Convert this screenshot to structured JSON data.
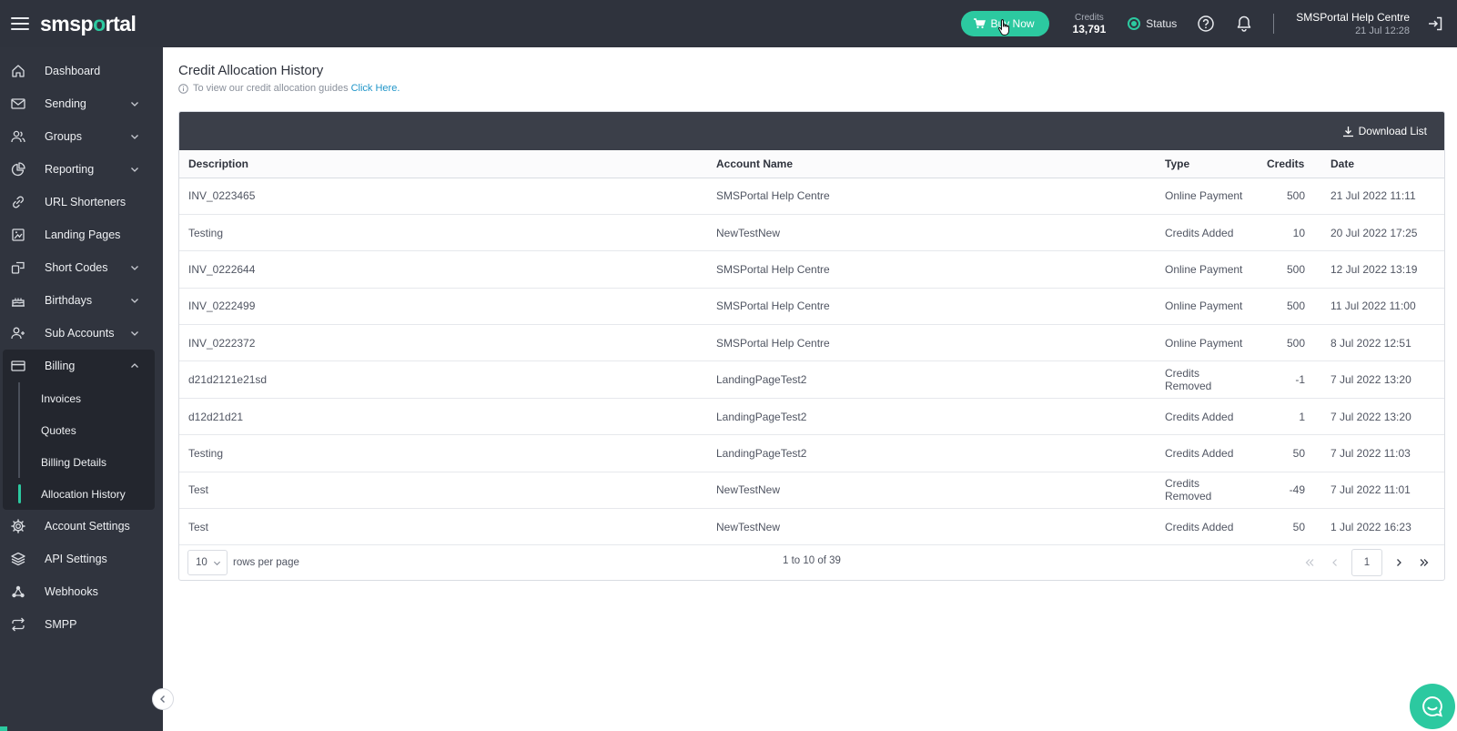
{
  "header": {
    "logo_prefix": "sms",
    "logo_o": "p",
    "logo_accent": "o",
    "logo_suffix": "rtal",
    "buy_label": "Buy Now",
    "credits_label": "Credits",
    "credits_value": "13,791",
    "status_label": "Status",
    "user_name": "SMSPortal Help Centre",
    "user_date": "21 Jul 12:28"
  },
  "sidebar": {
    "items": [
      {
        "label": "Dashboard",
        "icon": "home-icon"
      },
      {
        "label": "Sending",
        "icon": "mail-icon"
      },
      {
        "label": "Groups",
        "icon": "users-icon"
      },
      {
        "label": "Reporting",
        "icon": "pie-chart-icon"
      },
      {
        "label": "URL Shorteners",
        "icon": "link-icon"
      },
      {
        "label": "Landing Pages",
        "icon": "page-icon"
      },
      {
        "label": "Short Codes",
        "icon": "short-codes-icon"
      },
      {
        "label": "Birthdays",
        "icon": "cake-icon"
      },
      {
        "label": "Sub Accounts",
        "icon": "user-plus-icon"
      },
      {
        "label": "Billing",
        "icon": "card-icon"
      },
      {
        "label": "Account Settings",
        "icon": "gear-icon"
      },
      {
        "label": "API Settings",
        "icon": "layers-icon"
      },
      {
        "label": "Webhooks",
        "icon": "webhook-icon"
      },
      {
        "label": "SMPP",
        "icon": "repeat-icon"
      }
    ],
    "billing_sub": [
      "Invoices",
      "Quotes",
      "Billing Details",
      "Allocation History"
    ]
  },
  "main": {
    "title": "Credit Allocation History",
    "hint_text": "To view our credit allocation guides",
    "hint_link": "Click Here.",
    "download_label": "Download List",
    "columns": [
      "Description",
      "Account Name",
      "Type",
      "Credits",
      "Date"
    ],
    "rows": [
      [
        "INV_0223465",
        "SMSPortal Help Centre",
        "Online Payment",
        "500",
        "21 Jul 2022 11:11"
      ],
      [
        "Testing",
        "NewTestNew",
        "Credits Added",
        "10",
        "20 Jul 2022 17:25"
      ],
      [
        "INV_0222644",
        "SMSPortal Help Centre",
        "Online Payment",
        "500",
        "12 Jul 2022 13:19"
      ],
      [
        "INV_0222499",
        "SMSPortal Help Centre",
        "Online Payment",
        "500",
        "11 Jul 2022 11:00"
      ],
      [
        "INV_0222372",
        "SMSPortal Help Centre",
        "Online Payment",
        "500",
        "8 Jul 2022 12:51"
      ],
      [
        "d21d2121e21sd",
        "LandingPageTest2",
        "Credits Removed",
        "-1",
        "7 Jul 2022 13:20"
      ],
      [
        "d12d21d21",
        "LandingPageTest2",
        "Credits Added",
        "1",
        "7 Jul 2022 13:20"
      ],
      [
        "Testing",
        "LandingPageTest2",
        "Credits Added",
        "50",
        "7 Jul 2022 11:03"
      ],
      [
        "Test",
        "NewTestNew",
        "Credits Removed",
        "-49",
        "7 Jul 2022 11:01"
      ],
      [
        "Test",
        "NewTestNew",
        "Credits Added",
        "50",
        "1 Jul 2022 16:23"
      ]
    ],
    "rows_per_page_value": "10",
    "rows_per_page_label": "rows per page",
    "range_text": "1 to 10 of 39",
    "current_page": "1"
  },
  "colors": {
    "accent": "#2cc9a0",
    "topbar": "#2f333d",
    "sidebar": "#30343e",
    "link": "#2196c9"
  }
}
